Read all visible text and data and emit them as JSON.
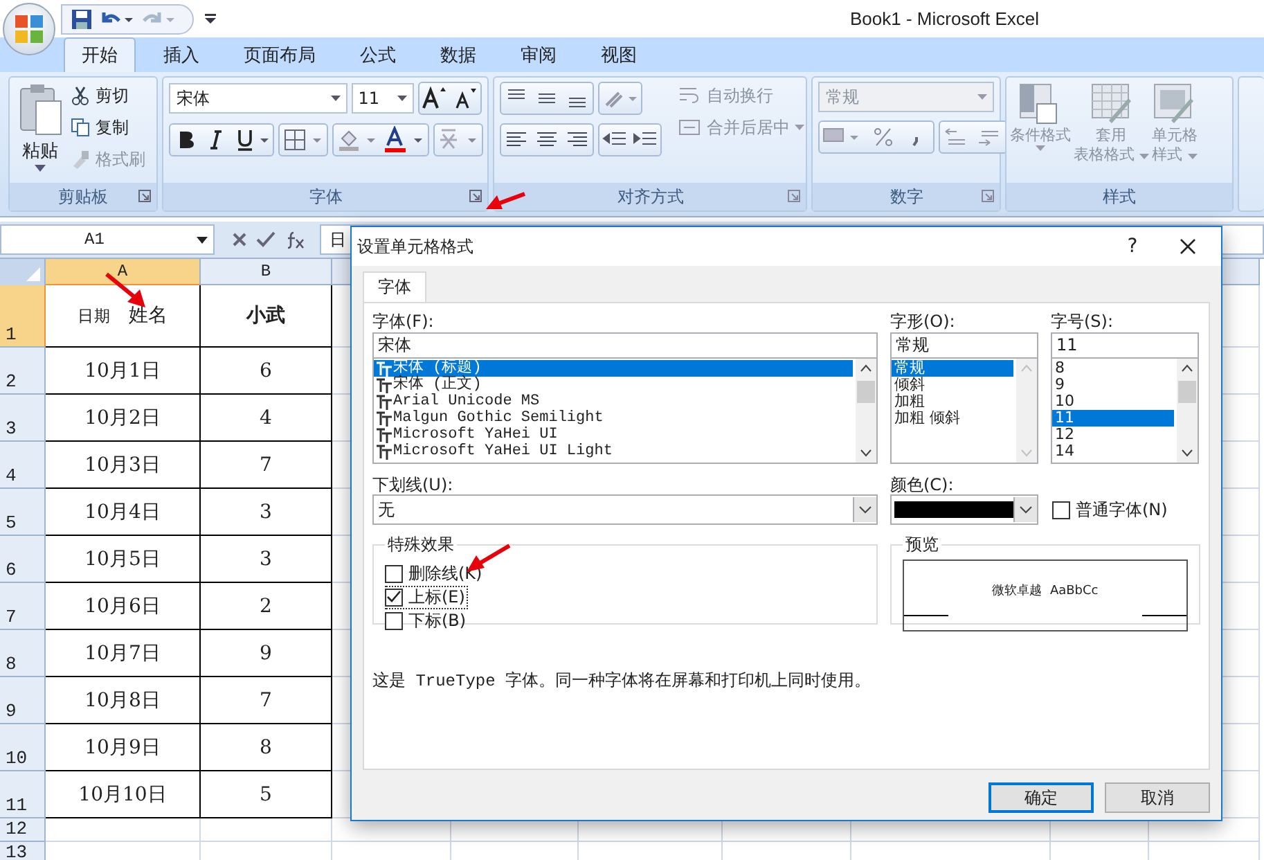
{
  "window": {
    "title": "Book1 - Microsoft Excel"
  },
  "tabs": [
    {
      "label": "开始",
      "selected": true
    },
    {
      "label": "插入",
      "selected": false
    },
    {
      "label": "页面布局",
      "selected": false
    },
    {
      "label": "公式",
      "selected": false
    },
    {
      "label": "数据",
      "selected": false
    },
    {
      "label": "审阅",
      "selected": false
    },
    {
      "label": "视图",
      "selected": false
    }
  ],
  "clipboard": {
    "label": "剪贴板",
    "paste": "粘贴",
    "cut": "剪切",
    "copy": "复制",
    "format_painter": "格式刷"
  },
  "font_group": {
    "label": "字体",
    "font": "宋体",
    "size": "11"
  },
  "alignment": {
    "label": "对齐方式",
    "wrap": "自动换行",
    "merge": "合并后居中"
  },
  "number": {
    "label": "数字",
    "format": "常规"
  },
  "styles": {
    "label": "样式",
    "conditional": "条件格式",
    "table": [
      "套用",
      "表格格式"
    ],
    "cell": [
      "单元格",
      "样式"
    ]
  },
  "formula_bar": {
    "name_box": "A1",
    "content": "日"
  },
  "sheet": {
    "columns": [
      {
        "label": "A",
        "selected": true
      },
      {
        "label": "B",
        "selected": false
      }
    ],
    "rows": [
      {
        "number": "1",
        "selected": true,
        "cells": [
          "$_{日期}$   姓名",
          "**小武**"
        ]
      },
      {
        "number": "2",
        "selected": false,
        "cells": [
          "10月1日",
          "6"
        ]
      },
      {
        "number": "3",
        "selected": false,
        "cells": [
          "10月2日",
          "4"
        ]
      },
      {
        "number": "4",
        "selected": false,
        "cells": [
          "10月3日",
          "7"
        ]
      },
      {
        "number": "5",
        "selected": false,
        "cells": [
          "10月4日",
          "3"
        ]
      },
      {
        "number": "6",
        "selected": false,
        "cells": [
          "10月5日",
          "3"
        ]
      },
      {
        "number": "7",
        "selected": false,
        "cells": [
          "10月6日",
          "2"
        ]
      },
      {
        "number": "8",
        "selected": false,
        "cells": [
          "10月7日",
          "9"
        ]
      },
      {
        "number": "9",
        "selected": false,
        "cells": [
          "10月8日",
          "7"
        ]
      },
      {
        "number": "10",
        "selected": false,
        "cells": [
          "10月9日",
          "8"
        ]
      },
      {
        "number": "11",
        "selected": false,
        "cells": [
          "10月10日",
          "5"
        ]
      },
      {
        "number": "12",
        "selected": false,
        "cells": []
      },
      {
        "number": "13",
        "selected": false,
        "cells": []
      }
    ]
  },
  "dialog": {
    "title": "设置单元格格式",
    "help": "?",
    "tabs": [
      {
        "label": "字体",
        "selected": true
      }
    ],
    "font": {
      "label": "字体(F):",
      "value": "宋体",
      "options": [
        {
          "label": "宋体 (标题)",
          "selected": true
        },
        {
          "label": "宋体 (正文)",
          "selected": false
        },
        {
          "label": "Arial Unicode MS",
          "selected": false
        },
        {
          "label": "Malgun Gothic Semilight",
          "selected": false
        },
        {
          "label": "Microsoft YaHei UI",
          "selected": false
        },
        {
          "label": "Microsoft YaHei UI Light",
          "selected": false
        }
      ]
    },
    "style": {
      "label": "字形(O):",
      "value": "常规",
      "options": [
        {
          "label": "常规",
          "selected": true
        },
        {
          "label": "倾斜",
          "selected": false
        },
        {
          "label": "加粗",
          "selected": false
        },
        {
          "label": "加粗 倾斜",
          "selected": false
        }
      ]
    },
    "size": {
      "label": "字号(S):",
      "value": "11",
      "options": [
        {
          "label": "8",
          "selected": false
        },
        {
          "label": "9",
          "selected": false
        },
        {
          "label": "10",
          "selected": false
        },
        {
          "label": "11",
          "selected": true
        },
        {
          "label": "12",
          "selected": false
        },
        {
          "label": "14",
          "selected": false
        }
      ]
    },
    "underline": {
      "label": "下划线(U):",
      "value": "无"
    },
    "color": {
      "label": "颜色(C):"
    },
    "normal_font": {
      "label": "普通字体(N)",
      "checked": false
    },
    "effects": {
      "label": "特殊效果",
      "items": [
        {
          "label": "删除线(K)",
          "checked": false
        },
        {
          "label": "上标(E)",
          "checked": true
        },
        {
          "label": "下标(B)",
          "checked": false
        }
      ]
    },
    "preview": {
      "label": "预览",
      "sample": "微软卓越  AaBbCc"
    },
    "note": "这是 TrueType 字体。同一种字体将在屏幕和打印机上同时使用。",
    "buttons": [
      {
        "label": "确定",
        "default": true
      },
      {
        "label": "取消",
        "default": false
      }
    ]
  }
}
